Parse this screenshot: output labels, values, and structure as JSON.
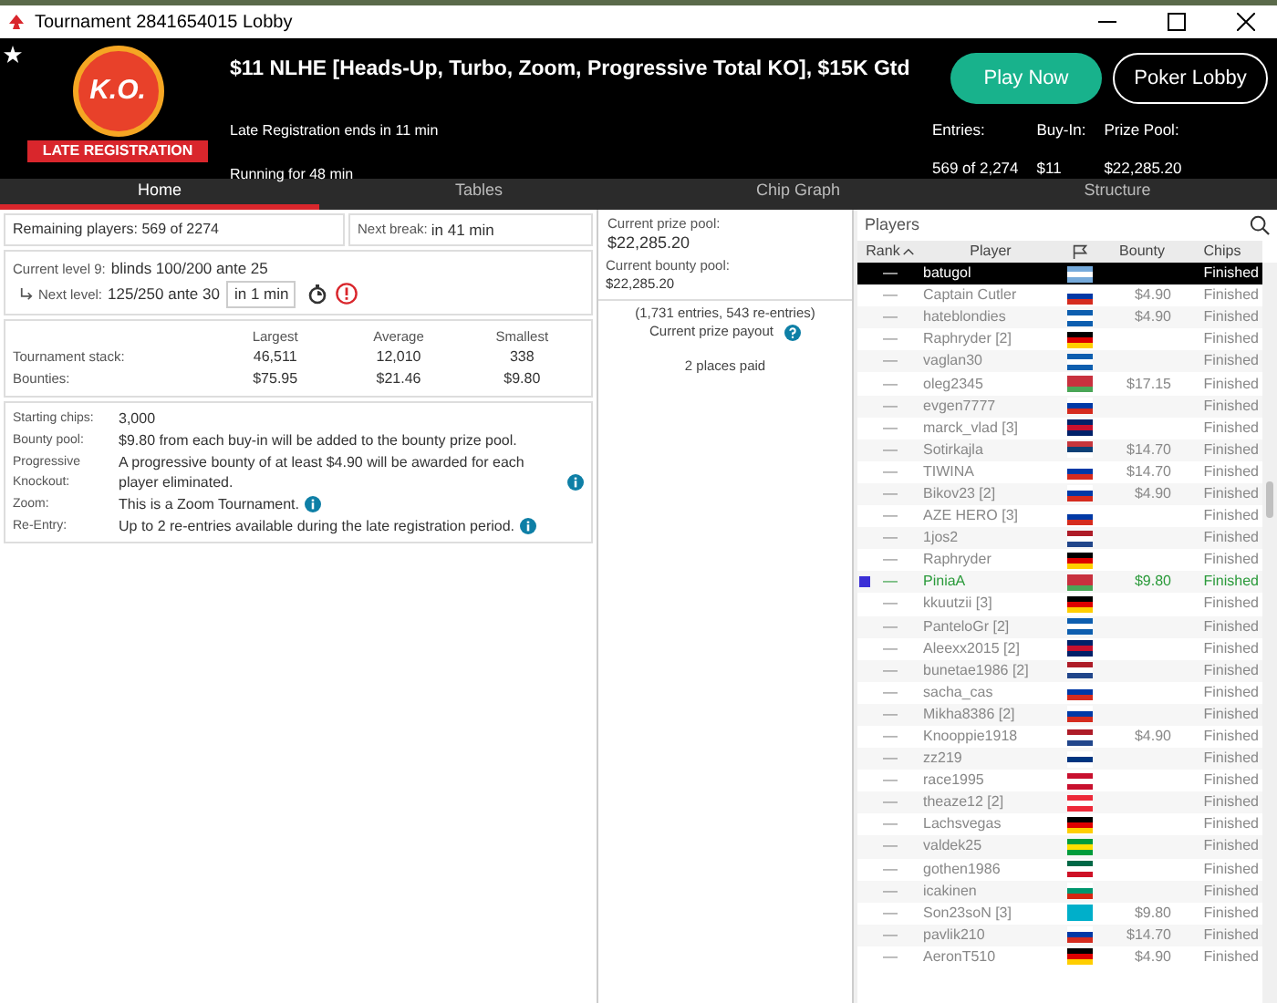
{
  "window": {
    "title": "Tournament 2841654015 Lobby"
  },
  "header": {
    "favorite": true,
    "badge_logo": "K.O.",
    "badge_label": "LATE REGISTRATION",
    "title": "$11 NLHE [Heads-Up, Turbo, Zoom, Progressive Total KO], $15K Gtd",
    "late_registration": "Late Registration ends in 11 min",
    "running": "Running for 48 min",
    "buttons": [
      "Play Now",
      "Poker Lobby"
    ],
    "stats": [
      {
        "label": "Entries:",
        "value": "569 of 2,274"
      },
      {
        "label": "Buy-In:",
        "value": "$11"
      },
      {
        "label": "Prize Pool:",
        "value": "$22,285.20"
      }
    ]
  },
  "tabs": [
    {
      "label": "Home",
      "selected": true
    },
    {
      "label": "Tables",
      "selected": false
    },
    {
      "label": "Chip Graph",
      "selected": false
    },
    {
      "label": "Structure",
      "selected": false
    }
  ],
  "home": {
    "remaining": "Remaining players: 569 of 2274",
    "next_break_label": "Next break:",
    "next_break": "in 41 min",
    "current_level_label": "Current level 9:",
    "current_level": "blinds 100/200 ante 25",
    "next_level_label": "Next level:",
    "next_level": "125/250 ante 30",
    "next_level_in": "in 1 min",
    "stacks": {
      "columns": [
        "Largest",
        "Average",
        "Smallest"
      ],
      "rows": [
        {
          "label": "Tournament stack:",
          "values": [
            "46,511",
            "12,010",
            "338"
          ]
        },
        {
          "label": "Bounties:",
          "values": [
            "$75.95",
            "$21.46",
            "$9.80"
          ]
        }
      ]
    },
    "info": [
      {
        "label": "Starting chips:",
        "text": "3,000",
        "info": false
      },
      {
        "label": "Bounty pool:",
        "text": "$9.80 from each buy-in will be added to the bounty prize pool.",
        "info": false
      },
      {
        "label": "Progressive Knockout:",
        "text": "A progressive bounty of at least $4.90 will be awarded for each player eliminated.",
        "info": true
      },
      {
        "label": "Zoom:",
        "text": "This is a Zoom Tournament.",
        "info": true
      },
      {
        "label": "Re-Entry:",
        "text": "Up to 2 re-entries available during the late registration period.",
        "info": true
      }
    ]
  },
  "prizes": {
    "prize_pool_label": "Current prize pool:",
    "prize_pool": "$22,285.20",
    "bounty_pool_label": "Current bounty pool:",
    "bounty_pool": "$22,285.20",
    "entries": "(1,731 entries, 543 re-entries)",
    "payout": "Current prize payout",
    "paid": "2 places paid"
  },
  "players": {
    "title": "Players",
    "columns": [
      "Rank",
      "Player",
      "Bounty",
      "Chips"
    ],
    "rows": [
      {
        "rank": "—",
        "name": "batugol",
        "bounty": "",
        "chips": "Finished",
        "selected": true,
        "hero": false,
        "flag": {
          "kind": "argentina"
        }
      },
      {
        "rank": "—",
        "name": "Captain Cutler",
        "bounty": "$4.90",
        "chips": "Finished",
        "selected": false,
        "hero": false,
        "flag": {
          "kind": "russia"
        }
      },
      {
        "rank": "—",
        "name": "hateblondies",
        "bounty": "$4.90",
        "chips": "Finished",
        "selected": false,
        "hero": false,
        "flag": {
          "kind": "greece"
        }
      },
      {
        "rank": "—",
        "name": "Raphryder [2]",
        "bounty": "",
        "chips": "Finished",
        "selected": false,
        "hero": false,
        "flag": {
          "kind": "germany"
        }
      },
      {
        "rank": "—",
        "name": "vaglan30",
        "bounty": "",
        "chips": "Finished",
        "selected": false,
        "hero": false,
        "flag": {
          "kind": "greece"
        }
      },
      {
        "rank": "—",
        "name": "oleg2345",
        "bounty": "$17.15",
        "chips": "Finished",
        "selected": false,
        "hero": false,
        "flag": {
          "kind": "belarus"
        }
      },
      {
        "rank": "—",
        "name": "evgen7777",
        "bounty": "",
        "chips": "Finished",
        "selected": false,
        "hero": false,
        "flag": {
          "kind": "russia"
        }
      },
      {
        "rank": "—",
        "name": "marck_vlad [3]",
        "bounty": "",
        "chips": "Finished",
        "selected": false,
        "hero": false,
        "flag": {
          "kind": "uk"
        }
      },
      {
        "rank": "—",
        "name": "Sotirkajla",
        "bounty": "$14.70",
        "chips": "Finished",
        "selected": false,
        "hero": false,
        "flag": {
          "kind": "serbia"
        }
      },
      {
        "rank": "—",
        "name": "TIWINA",
        "bounty": "$14.70",
        "chips": "Finished",
        "selected": false,
        "hero": false,
        "flag": {
          "kind": "russia"
        }
      },
      {
        "rank": "—",
        "name": "Bikov23 [2]",
        "bounty": "$4.90",
        "chips": "Finished",
        "selected": false,
        "hero": false,
        "flag": {
          "kind": "russia"
        }
      },
      {
        "rank": "—",
        "name": "AZE HERO [3]",
        "bounty": "",
        "chips": "Finished",
        "selected": false,
        "hero": false,
        "flag": {
          "kind": "russia"
        }
      },
      {
        "rank": "—",
        "name": "1jos2",
        "bounty": "",
        "chips": "Finished",
        "selected": false,
        "hero": false,
        "flag": {
          "kind": "netherlands"
        }
      },
      {
        "rank": "—",
        "name": "Raphryder",
        "bounty": "",
        "chips": "Finished",
        "selected": false,
        "hero": false,
        "flag": {
          "kind": "germany"
        }
      },
      {
        "rank": "—",
        "name": "PiniaA",
        "bounty": "$9.80",
        "chips": "Finished",
        "selected": false,
        "hero": true,
        "flag": {
          "kind": "belarus"
        }
      },
      {
        "rank": "—",
        "name": "kkuutzii [3]",
        "bounty": "",
        "chips": "Finished",
        "selected": false,
        "hero": false,
        "flag": {
          "kind": "germany"
        }
      },
      {
        "rank": "—",
        "name": "PanteloGr [2]",
        "bounty": "",
        "chips": "Finished",
        "selected": false,
        "hero": false,
        "flag": {
          "kind": "greece"
        }
      },
      {
        "rank": "—",
        "name": "Aleexx2015 [2]",
        "bounty": "",
        "chips": "Finished",
        "selected": false,
        "hero": false,
        "flag": {
          "kind": "uk"
        }
      },
      {
        "rank": "—",
        "name": "bunetae1986 [2]",
        "bounty": "",
        "chips": "Finished",
        "selected": false,
        "hero": false,
        "flag": {
          "kind": "netherlands"
        }
      },
      {
        "rank": "—",
        "name": "sacha_cas",
        "bounty": "",
        "chips": "Finished",
        "selected": false,
        "hero": false,
        "flag": {
          "kind": "russia"
        }
      },
      {
        "rank": "—",
        "name": "Mikha8386 [2]",
        "bounty": "",
        "chips": "Finished",
        "selected": false,
        "hero": false,
        "flag": {
          "kind": "russia"
        }
      },
      {
        "rank": "—",
        "name": "Knooppie1918",
        "bounty": "$4.90",
        "chips": "Finished",
        "selected": false,
        "hero": false,
        "flag": {
          "kind": "netherlands"
        }
      },
      {
        "rank": "—",
        "name": "zz219",
        "bounty": "",
        "chips": "Finished",
        "selected": false,
        "hero": false,
        "flag": {
          "kind": "finland"
        }
      },
      {
        "rank": "—",
        "name": "race1995",
        "bounty": "",
        "chips": "Finished",
        "selected": false,
        "hero": false,
        "flag": {
          "kind": "denmark"
        }
      },
      {
        "rank": "—",
        "name": "theaze12 [2]",
        "bounty": "",
        "chips": "Finished",
        "selected": false,
        "hero": false,
        "flag": {
          "kind": "austria"
        }
      },
      {
        "rank": "—",
        "name": "Lachsvegas",
        "bounty": "",
        "chips": "Finished",
        "selected": false,
        "hero": false,
        "flag": {
          "kind": "germany"
        }
      },
      {
        "rank": "—",
        "name": "valdek25",
        "bounty": "",
        "chips": "Finished",
        "selected": false,
        "hero": false,
        "flag": {
          "kind": "brazil"
        }
      },
      {
        "rank": "—",
        "name": "gothen1986",
        "bounty": "",
        "chips": "Finished",
        "selected": false,
        "hero": false,
        "flag": {
          "kind": "mexico"
        }
      },
      {
        "rank": "—",
        "name": "icakinen",
        "bounty": "",
        "chips": "Finished",
        "selected": false,
        "hero": false,
        "flag": {
          "kind": "bulgaria"
        }
      },
      {
        "rank": "—",
        "name": "Son23soN [3]",
        "bounty": "$9.80",
        "chips": "Finished",
        "selected": false,
        "hero": false,
        "flag": {
          "kind": "kazakhstan"
        }
      },
      {
        "rank": "—",
        "name": "pavlik210",
        "bounty": "$14.70",
        "chips": "Finished",
        "selected": false,
        "hero": false,
        "flag": {
          "kind": "russia"
        }
      },
      {
        "rank": "—",
        "name": "AeronT510",
        "bounty": "$4.90",
        "chips": "Finished",
        "selected": false,
        "hero": false,
        "flag": {
          "kind": "germany"
        }
      }
    ]
  }
}
